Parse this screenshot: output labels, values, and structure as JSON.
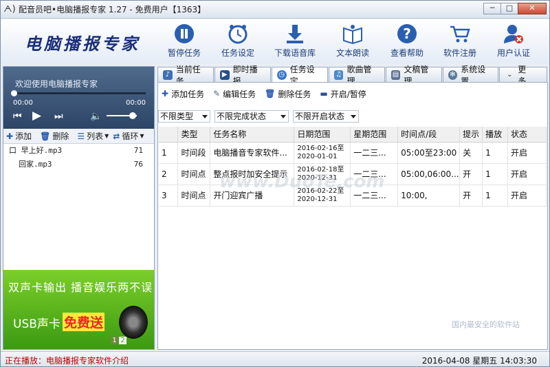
{
  "window": {
    "title": "配音员吧•电脑播报专家 1.27 - 免费用户【1363】",
    "btn_min": "─",
    "btn_max": "□",
    "btn_close": "✕"
  },
  "header": {
    "logo": "电脑播报专家",
    "tools": [
      {
        "label": "暂停任务",
        "icon": "pause-icon"
      },
      {
        "label": "任务设定",
        "icon": "alarm-clock-icon"
      },
      {
        "label": "下载语音库",
        "icon": "download-icon"
      },
      {
        "label": "文本朗读",
        "icon": "book-icon"
      },
      {
        "label": "查看帮助",
        "icon": "help-icon"
      },
      {
        "label": "软件注册",
        "icon": "cart-icon"
      },
      {
        "label": "用户认证",
        "icon": "user-icon"
      }
    ]
  },
  "player": {
    "title": "欢迎使用电脑播报专家",
    "time_current": "00:00",
    "time_total": "00:00",
    "volume_level": 0.75,
    "progress": 0.0
  },
  "playlist_toolbar": {
    "add": "添加",
    "delete": "删除",
    "list": "列表",
    "loop": "循环"
  },
  "playlist": [
    {
      "prefix": "口",
      "name": "早上好.mp3",
      "num": "71"
    },
    {
      "prefix": "",
      "name": "回家.mp3",
      "num": "76"
    }
  ],
  "ad": {
    "line1": "双声卡输出 播音娱乐两不误",
    "line2": "USB声卡",
    "highlight": "免费送",
    "page1": "1",
    "page2": "2"
  },
  "tabs": [
    {
      "label": "当前任务",
      "icon": "bell-icon",
      "color": "#3d6fb8"
    },
    {
      "label": "即时播报",
      "icon": "play-circle-icon",
      "color": "#2a4f8a"
    },
    {
      "label": "任务设定",
      "icon": "clock-icon",
      "color": "#3a7ac8"
    },
    {
      "label": "歌曲管理",
      "icon": "music-note-icon",
      "color": "#4a88d0"
    },
    {
      "label": "文稿管理",
      "icon": "document-icon",
      "color": "#5a7090"
    },
    {
      "label": "系统设置",
      "icon": "gear-icon",
      "color": "#5a7a9a"
    },
    {
      "label": "更多...",
      "icon": "chevron-down-icon",
      "color": "#6a7a90"
    }
  ],
  "content_toolbar": {
    "add": "添加任务",
    "edit": "编辑任务",
    "delete": "删除任务",
    "toggle": "开启/暂停"
  },
  "filters": {
    "type": "不限类型",
    "done": "不限完成状态",
    "open": "不限开启状态"
  },
  "table": {
    "columns": [
      "",
      "类型",
      "任务名称",
      "日期范围",
      "星期范围",
      "时间点/段",
      "提示",
      "播放",
      "状态"
    ],
    "rows": [
      [
        "1",
        "时间段",
        "电脑播音专家软件...",
        "2016-02-16至 2020-01-01",
        "一二三...",
        "05:00至23:00",
        "关",
        "1",
        "开启"
      ],
      [
        "2",
        "时间点",
        "整点报时加安全提示",
        "2016-02-18至 2020-12-31",
        "一二三...",
        "05:00,06:00...",
        "开",
        "1",
        "开启"
      ],
      [
        "3",
        "时间点",
        "开门迎宾广播",
        "2016-02-22至 2020-12-31",
        "一二三...",
        "10:00,",
        "开",
        "1",
        "开启"
      ]
    ]
  },
  "status": {
    "now_playing": "正在播放：电脑播报专家软件介绍",
    "datetime": "2016-04-08 星期五 14:03:30"
  },
  "watermark": {
    "center": "www.DuoTe.com",
    "corner": "国内最安全的软件站"
  }
}
